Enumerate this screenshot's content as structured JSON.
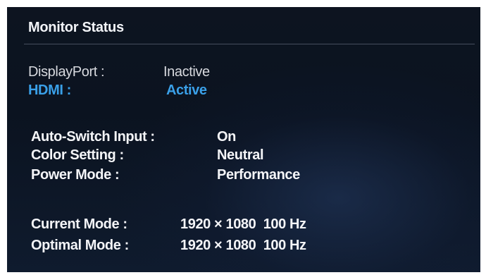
{
  "title": "Monitor Status",
  "inputs": [
    {
      "label": "DisplayPort :",
      "value": "Inactive"
    },
    {
      "label": "HDMI :",
      "value": "Active"
    }
  ],
  "settings": [
    {
      "label": "Auto-Switch Input :",
      "value": "On"
    },
    {
      "label": "Color Setting :",
      "value": "Neutral"
    },
    {
      "label": "Power Mode :",
      "value": "Performance"
    }
  ],
  "modes": [
    {
      "label": "Current Mode :",
      "value": "1920 × 1080  100 Hz"
    },
    {
      "label": "Optimal Mode :",
      "value": "1920 × 1080  100 Hz"
    }
  ],
  "colors": {
    "background": "#0d1420",
    "text": "#ffffff",
    "active_highlight": "#3aa0e8"
  }
}
